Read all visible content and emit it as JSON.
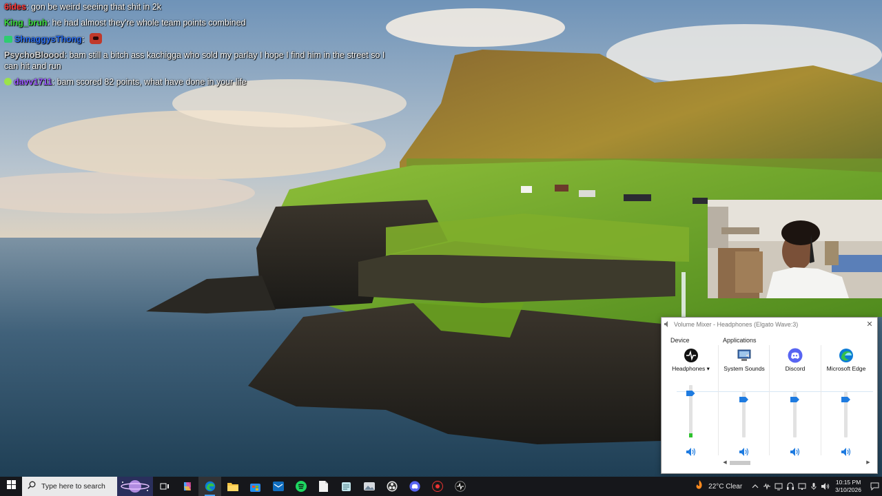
{
  "chat": {
    "messages": [
      {
        "user": "6ides",
        "separator": ":",
        "text": "gon be weird seeing that shit in 2k",
        "color": "#ff3b3b",
        "badge": ""
      },
      {
        "user": "King_bruh",
        "separator": ":",
        "text": "he had almost they're whole team points combined",
        "color": "#3ddc3d",
        "badge": ""
      },
      {
        "user": "ShnaggysThong",
        "separator": ":",
        "text": "",
        "color": "#2a6df0",
        "badge": "#2ecc71",
        "emote": "red-demon-emote"
      },
      {
        "user": "PsychoBloood",
        "separator": ":",
        "text": "bam still a bitch ass kachigga who sold my parlay I hope I find him in the street so I can hit and run",
        "color": "#d8d8d8",
        "badge": ""
      },
      {
        "user": "davv1711",
        "separator": ":",
        "text": "bam scored 82 points, what have done in your life",
        "color": "#9b59ff",
        "badge": "#9be34a"
      }
    ]
  },
  "mixer": {
    "title": "Volume Mixer - Headphones (Elgato Wave:3)",
    "close_glyph": "✕",
    "device_label": "Device",
    "applications_label": "Applications",
    "device": {
      "name": "Headphones",
      "dropdown_glyph": "▾",
      "volume_fraction": 0.86,
      "peak_fraction": 0.08
    },
    "apps": [
      {
        "name": "System Sounds",
        "icon": "system-sounds-icon",
        "volume_fraction": 1.0
      },
      {
        "name": "Discord",
        "icon": "discord-icon",
        "volume_fraction": 1.0
      },
      {
        "name": "Microsoft Edge",
        "icon": "microsoft-edge-icon",
        "volume_fraction": 1.0
      }
    ],
    "scroll_left_glyph": "◀",
    "scroll_right_glyph": "▶"
  },
  "taskbar": {
    "search_placeholder": "Type here to search",
    "pinned": [
      "task-view-icon",
      "copilot-icon",
      "microsoft-edge-icon",
      "file-explorer-icon",
      "microsoft-store-icon",
      "mail-icon",
      "spotify-icon",
      "notepad-icon",
      "notes-icon",
      "photos-icon",
      "obs-icon",
      "discord-icon",
      "stream-deck-icon",
      "elgato-wave-link-icon"
    ],
    "weather": {
      "temp": "22°C",
      "condition": "Clear"
    },
    "clock": {
      "time": "10:15 PM",
      "date": "3/10/2026"
    }
  },
  "colors": {
    "accent": "#1e7be0",
    "taskbar": "#16171b",
    "meter_green": "#2ec22e"
  }
}
